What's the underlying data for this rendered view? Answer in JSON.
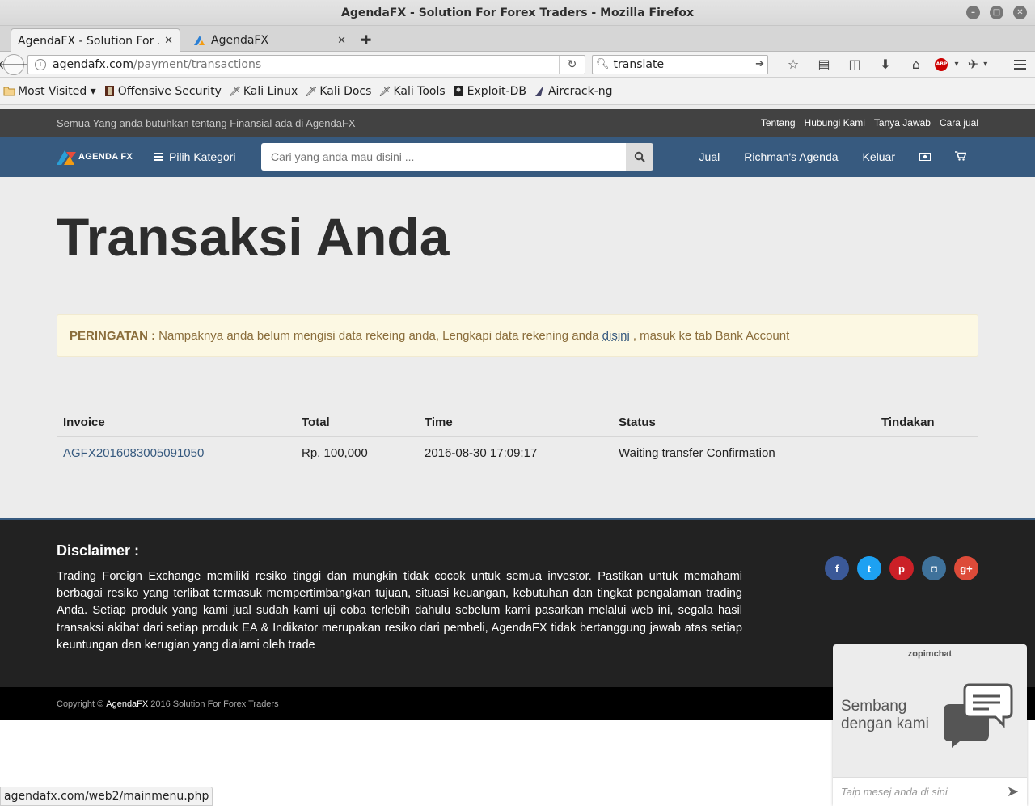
{
  "window": {
    "title": "AgendaFX - Solution For Forex Traders - Mozilla Firefox"
  },
  "tabs": [
    {
      "label": "AgendaFX - Solution For ..."
    },
    {
      "label": "AgendaFX"
    }
  ],
  "urlbar": {
    "host": "agendafx.com",
    "path": "/payment/transactions"
  },
  "searchbar": {
    "value": "translate"
  },
  "bookmarks": [
    {
      "label": "Most Visited ▾"
    },
    {
      "label": "Offensive Security"
    },
    {
      "label": "Kali Linux"
    },
    {
      "label": "Kali Docs"
    },
    {
      "label": "Kali Tools"
    },
    {
      "label": "Exploit-DB"
    },
    {
      "label": "Aircrack-ng"
    }
  ],
  "topbar": {
    "tagline": "Semua Yang anda butuhkan tentang Finansial ada di AgendaFX",
    "links": [
      "Tentang",
      "Hubungi Kami",
      "Tanya Jawab",
      "Cara jual"
    ]
  },
  "mainnav": {
    "logo_text": "AGENDA FX",
    "category_label": "Pilih Kategori",
    "search_placeholder": "Cari yang anda mau disini ...",
    "links": [
      "Jual",
      "Richman's Agenda",
      "Keluar"
    ]
  },
  "page": {
    "title": "Transaksi Anda",
    "warning": {
      "label": "PERINGATAN :",
      "text_before": "Nampaknya anda belum mengisi data rekeing anda, Lengkapi data rekening anda",
      "link": "disini",
      "text_after": ", masuk ke tab Bank Account"
    }
  },
  "table": {
    "headers": [
      "Invoice",
      "Total",
      "Time",
      "Status",
      "Tindakan"
    ],
    "rows": [
      {
        "invoice": "AGFX2016083005091050",
        "total": "Rp. 100,000",
        "time": "2016-08-30 17:09:17",
        "status": "Waiting transfer Confirmation",
        "action": ""
      }
    ]
  },
  "footer": {
    "disclaimer_title": "Disclaimer :",
    "disclaimer_text": "Trading Foreign Exchange memiliki resiko tinggi dan mungkin tidak cocok untuk semua investor. Pastikan untuk memahami berbagai resiko yang terlibat termasuk mempertimbangkan tujuan, situasi keuangan, kebutuhan dan tingkat pengalaman trading Anda. Setiap produk yang kami jual sudah kami uji coba terlebih dahulu sebelum kami pasarkan melalui web ini, segala hasil transaksi akibat dari setiap produk EA & Indikator merupakan resiko dari pembeli, AgendaFX tidak bertanggung jawab atas setiap keuntungan dan kerugian yang dialami oleh trade",
    "socials": [
      {
        "name": "facebook-icon",
        "glyph": "f",
        "color": "#3b5998"
      },
      {
        "name": "twitter-icon",
        "glyph": "t",
        "color": "#1da1f2"
      },
      {
        "name": "pinterest-icon",
        "glyph": "p",
        "color": "#cb2027"
      },
      {
        "name": "instagram-icon",
        "glyph": "◘",
        "color": "#3f729b"
      },
      {
        "name": "google-plus-icon",
        "glyph": "g+",
        "color": "#dd4b39"
      }
    ],
    "copyright_prefix": "Copyright ©",
    "copyright_brand": "AgendaFX",
    "copyright_suffix": "2016 Solution For Forex Traders"
  },
  "statusbar": {
    "url": "agendafx.com/web2/mainmenu.php"
  },
  "chat": {
    "brand": "zopimchat",
    "message": "Sembang dengan kami",
    "input_placeholder": "Taip mesej anda di sini"
  },
  "colors": {
    "nav_blue": "#375a7f",
    "topbar_gray": "#424242",
    "footer_dark": "#222222",
    "warning_bg": "#fcf8e3",
    "warning_text": "#8a6d3b"
  }
}
